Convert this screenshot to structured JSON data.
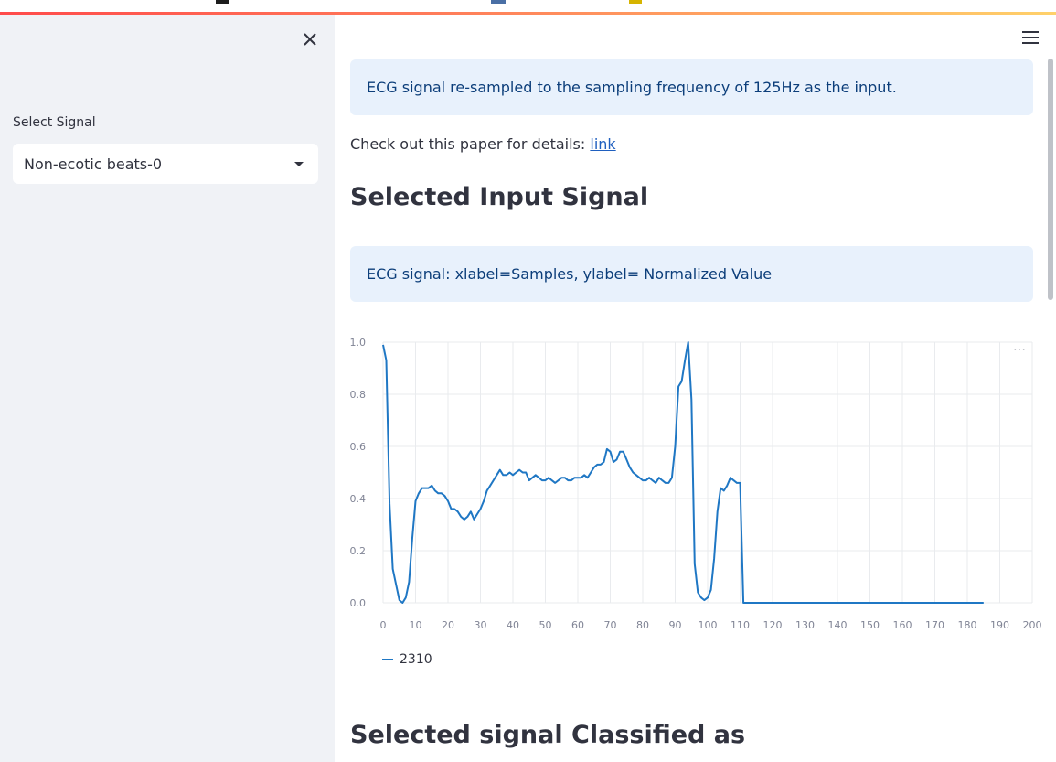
{
  "sidebar": {
    "select_label": "Select Signal",
    "selected_value": "Non-ecotic beats-0"
  },
  "main": {
    "info_resample": "ECG signal re-sampled to the sampling frequency of 125Hz as the input.",
    "paper_text": "Check out this paper for details: ",
    "paper_link": "link",
    "heading_input": "Selected Input Signal",
    "info_axes": "ECG signal: xlabel=Samples, ylabel= Normalized Value",
    "heading_classified": "Selected signal Classified as"
  },
  "colors": {
    "series": "#1f77c4",
    "info_bg": "#e8f1fc",
    "sidebar_bg": "#f0f2f6"
  },
  "chart_data": {
    "type": "line",
    "xlim": [
      0,
      200
    ],
    "ylim": [
      0,
      1
    ],
    "x_ticks": [
      0,
      10,
      20,
      30,
      40,
      50,
      60,
      70,
      80,
      90,
      100,
      110,
      120,
      130,
      140,
      150,
      160,
      170,
      180,
      190,
      200
    ],
    "y_ticks": [
      0,
      0.2,
      0.4,
      0.6,
      0.8,
      1.0
    ],
    "y_tick_labels": [
      "0.0",
      "0.2",
      "0.4",
      "0.6",
      "0.8",
      "1.0"
    ],
    "grid": true,
    "legend_position": "bottom-left",
    "series": [
      {
        "name": "2310",
        "x": [
          0,
          1,
          2,
          3,
          4,
          5,
          6,
          7,
          8,
          9,
          10,
          11,
          12,
          13,
          14,
          15,
          16,
          17,
          18,
          19,
          20,
          21,
          22,
          23,
          24,
          25,
          26,
          27,
          28,
          29,
          30,
          31,
          32,
          33,
          34,
          35,
          36,
          37,
          38,
          39,
          40,
          41,
          42,
          43,
          44,
          45,
          46,
          47,
          48,
          49,
          50,
          51,
          52,
          53,
          54,
          55,
          56,
          57,
          58,
          59,
          60,
          61,
          62,
          63,
          64,
          65,
          66,
          67,
          68,
          69,
          70,
          71,
          72,
          73,
          74,
          75,
          76,
          77,
          78,
          79,
          80,
          81,
          82,
          83,
          84,
          85,
          86,
          87,
          88,
          89,
          90,
          91,
          92,
          93,
          94,
          95,
          96,
          97,
          98,
          99,
          100,
          101,
          102,
          103,
          104,
          105,
          106,
          107,
          108,
          109,
          110,
          111,
          112,
          113,
          120,
          130,
          140,
          150,
          160,
          170,
          180,
          185
        ],
        "y": [
          0.99,
          0.93,
          0.38,
          0.13,
          0.07,
          0.01,
          0.0,
          0.02,
          0.08,
          0.25,
          0.39,
          0.42,
          0.44,
          0.44,
          0.44,
          0.45,
          0.43,
          0.42,
          0.42,
          0.41,
          0.39,
          0.36,
          0.36,
          0.35,
          0.33,
          0.32,
          0.33,
          0.35,
          0.32,
          0.34,
          0.36,
          0.39,
          0.43,
          0.45,
          0.47,
          0.49,
          0.51,
          0.49,
          0.49,
          0.5,
          0.49,
          0.5,
          0.51,
          0.5,
          0.5,
          0.47,
          0.48,
          0.49,
          0.48,
          0.47,
          0.47,
          0.48,
          0.47,
          0.46,
          0.47,
          0.48,
          0.48,
          0.47,
          0.47,
          0.48,
          0.48,
          0.48,
          0.49,
          0.48,
          0.5,
          0.52,
          0.53,
          0.53,
          0.54,
          0.59,
          0.58,
          0.54,
          0.55,
          0.58,
          0.58,
          0.55,
          0.52,
          0.5,
          0.49,
          0.48,
          0.47,
          0.47,
          0.48,
          0.47,
          0.46,
          0.48,
          0.47,
          0.46,
          0.46,
          0.48,
          0.6,
          0.83,
          0.85,
          0.93,
          1.0,
          0.78,
          0.15,
          0.04,
          0.02,
          0.01,
          0.02,
          0.05,
          0.17,
          0.35,
          0.44,
          0.43,
          0.45,
          0.48,
          0.47,
          0.46,
          0.46,
          0.0,
          0.0,
          0.0,
          0.0,
          0.0,
          0.0,
          0.0,
          0.0,
          0.0,
          0.0,
          0.0
        ]
      }
    ]
  }
}
